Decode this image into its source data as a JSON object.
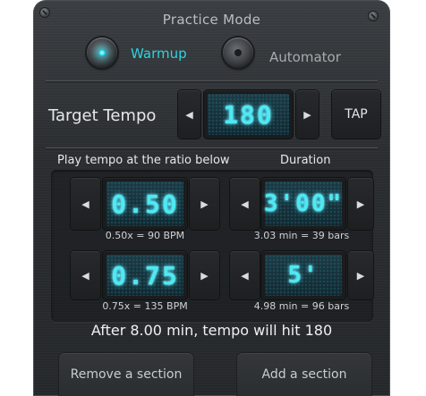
{
  "header": {
    "title": "Practice Mode"
  },
  "modes": [
    {
      "label": "Warmup",
      "active": true
    },
    {
      "label": "Automator",
      "active": false
    }
  ],
  "target_tempo": {
    "label": "Target Tempo",
    "value": "180",
    "decrement_glyph": "◀",
    "increment_glyph": "▶",
    "tap_label": "TAP"
  },
  "headers": {
    "ratio": "Play tempo at the ratio below",
    "duration": "Duration"
  },
  "rows": [
    {
      "ratio_value": "0.50",
      "ratio_caption": "0.50x = 90 BPM",
      "duration_value": "3'00\"",
      "duration_caption": "3.03 min = 39 bars"
    },
    {
      "ratio_value": "0.75",
      "ratio_caption": "0.75x = 135 BPM",
      "duration_value": "5'",
      "duration_caption": "4.98 min = 96 bars"
    }
  ],
  "summary": "After 8.00 min, tempo will hit 180",
  "actions": {
    "remove": "Remove a section",
    "add": "Add a section"
  },
  "colors": {
    "accent": "#2fd3e0",
    "lcd_text": "#4ce9f5",
    "panel": "#2c2f32"
  }
}
